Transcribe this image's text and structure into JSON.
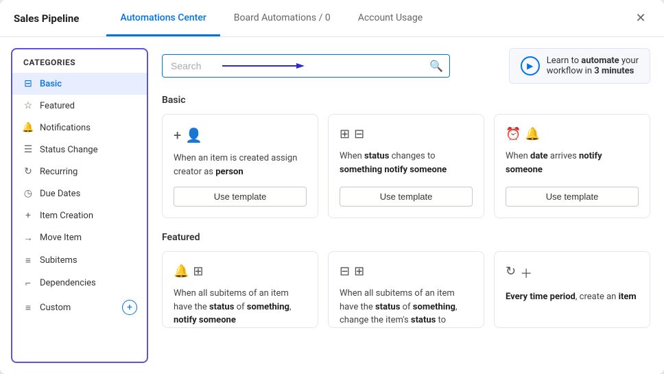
{
  "window": {
    "title": "Sales Pipeline",
    "close_label": "✕"
  },
  "header": {
    "tabs": [
      {
        "id": "automations-center",
        "label": "Automations Center",
        "active": true
      },
      {
        "id": "board-automations",
        "label": "Board Automations / 0",
        "active": false
      },
      {
        "id": "account-usage",
        "label": "Account Usage",
        "active": false
      }
    ]
  },
  "sidebar": {
    "header": "Categories",
    "items": [
      {
        "id": "basic",
        "label": "Basic",
        "icon": "⊟",
        "active": true
      },
      {
        "id": "featured",
        "label": "Featured",
        "icon": "☆",
        "active": false
      },
      {
        "id": "notifications",
        "label": "Notifications",
        "icon": "🔔",
        "active": false
      },
      {
        "id": "status-change",
        "label": "Status Change",
        "icon": "☰",
        "active": false
      },
      {
        "id": "recurring",
        "label": "Recurring",
        "icon": "↻",
        "active": false
      },
      {
        "id": "due-dates",
        "label": "Due Dates",
        "icon": "◷",
        "active": false
      },
      {
        "id": "item-creation",
        "label": "Item Creation",
        "icon": "+",
        "active": false
      },
      {
        "id": "move-item",
        "label": "Move Item",
        "icon": "→",
        "active": false
      },
      {
        "id": "subitems",
        "label": "Subitems",
        "icon": "≡",
        "active": false
      },
      {
        "id": "dependencies",
        "label": "Dependencies",
        "icon": "⌐",
        "active": false
      },
      {
        "id": "custom",
        "label": "Custom",
        "icon": "≡",
        "active": false
      }
    ]
  },
  "search": {
    "placeholder": "Search"
  },
  "learn_banner": {
    "text_prefix": "Learn to ",
    "text_bold": "automate",
    "text_middle": " your\nworkflow in ",
    "text_bold2": "3 minutes"
  },
  "basic_section": {
    "heading": "Basic",
    "cards": [
      {
        "id": "card-assign-creator",
        "icons": [
          "＋",
          "👤"
        ],
        "text_html": "When an item is created assign creator as <b>person</b>",
        "button_label": "Use template"
      },
      {
        "id": "card-status-notify",
        "icons": [
          "⊟⊟"
        ],
        "text_html": "When <b>status</b> changes to <b>something notify someone</b>",
        "button_label": "Use template"
      },
      {
        "id": "card-date-notify",
        "icons": [
          "⏰",
          "🔔"
        ],
        "text_html": "When <b>date</b> arrives <b>notify someone</b>",
        "button_label": "Use template"
      }
    ]
  },
  "featured_section": {
    "heading": "Featured",
    "cards": [
      {
        "id": "card-subitems-status-notify",
        "icons": [
          "🔔",
          "⊞"
        ],
        "text_html": "When all subitems of an item have the <b>status</b> of <b>something</b>, <b>notify someone</b>"
      },
      {
        "id": "card-subitems-status-change",
        "icons": [
          "⊟",
          "⊞"
        ],
        "text_html": "When all subitems of an item have the <b>status</b> of <b>something</b>, change the item's <b>status</b> to"
      },
      {
        "id": "card-time-period-create",
        "icons": [
          "↻",
          "＋"
        ],
        "text_html": "<b>Every time period</b>, create an <b>item</b>"
      }
    ]
  },
  "icons": {
    "search": "🔍",
    "play": "▶"
  }
}
